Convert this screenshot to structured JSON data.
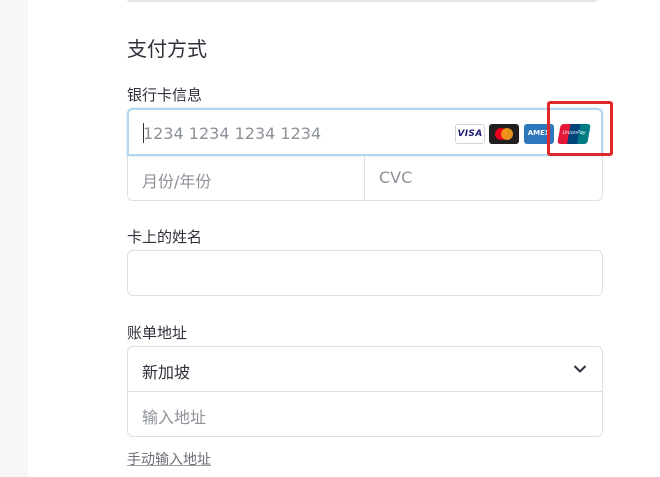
{
  "section": {
    "title": "支付方式"
  },
  "card_info": {
    "label": "银行卡信息",
    "number_placeholder": "1234 1234 1234 1234",
    "brands": [
      {
        "name": "visa",
        "text": "VISA"
      },
      {
        "name": "mastercard",
        "text": ""
      },
      {
        "name": "amex",
        "text": "AMEX"
      },
      {
        "name": "unionpay",
        "text": "UnionPay"
      }
    ],
    "expiry_placeholder": "月份/年份",
    "cvc_placeholder": "CVC"
  },
  "name_on_card": {
    "label": "卡上的姓名",
    "value": ""
  },
  "billing": {
    "label": "账单地址",
    "country": "新加坡",
    "address_placeholder": "输入地址",
    "manual_link": "手动输入地址"
  },
  "colors": {
    "highlight": "#e0282b",
    "focus_border": "#b3d7ef",
    "text": "#30313d",
    "placeholder": "#8d9299"
  }
}
